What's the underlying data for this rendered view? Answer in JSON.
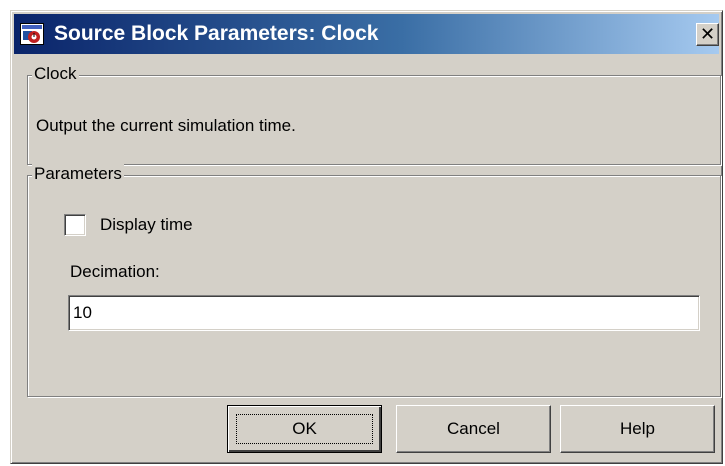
{
  "window": {
    "title": "Source Block Parameters: Clock",
    "close_glyph": "✕"
  },
  "clock_group": {
    "legend": "Clock",
    "description": "Output the current simulation time."
  },
  "parameters_group": {
    "legend": "Parameters",
    "display_time": {
      "label": "Display time",
      "checked": false
    },
    "decimation": {
      "label": "Decimation:",
      "value": "10"
    }
  },
  "buttons": {
    "ok": "OK",
    "cancel": "Cancel",
    "help": "Help"
  },
  "colors": {
    "dialog_bg": "#d4d0c8",
    "title_start": "#0a246a",
    "title_end": "#a6caf0"
  }
}
